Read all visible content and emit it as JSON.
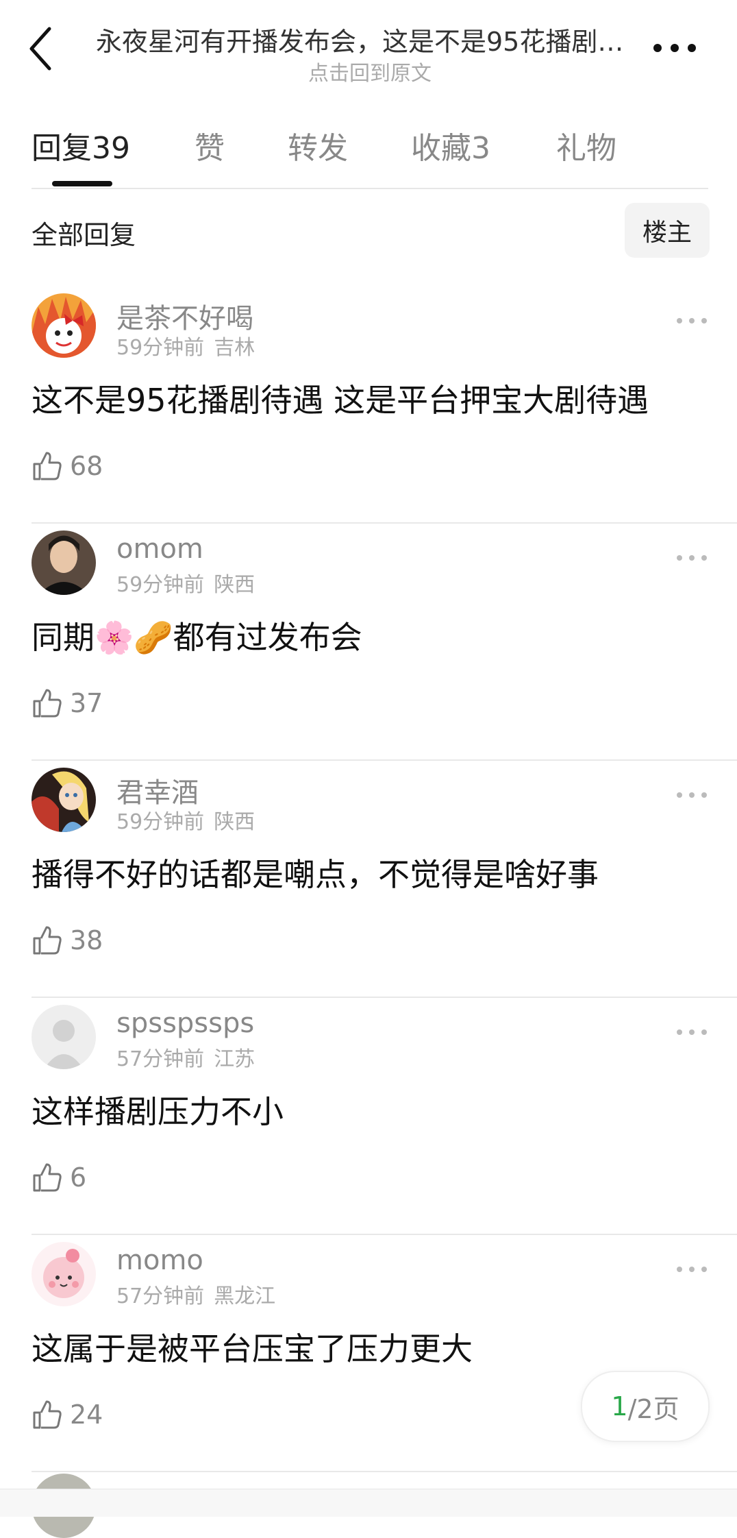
{
  "header": {
    "title": "永夜星河有开播发布会，这是不是95花播剧…",
    "subtitle": "点击回到原文"
  },
  "tabs": [
    {
      "label": "回复",
      "count": "39"
    },
    {
      "label": "赞",
      "count": ""
    },
    {
      "label": "转发",
      "count": ""
    },
    {
      "label": "收藏",
      "count": "3"
    },
    {
      "label": "礼物",
      "count": ""
    }
  ],
  "filter": {
    "label": "全部回复",
    "op_button": "楼主"
  },
  "comments": [
    {
      "user": "是茶不好喝",
      "time": "59分钟前",
      "location": "吉林",
      "text": "这不是95花播剧待遇 这是平台押宝大剧待遇",
      "likes": "68",
      "avatar": "cartoon-flame-avatar"
    },
    {
      "user": "omom",
      "time": "59分钟前",
      "location": "陕西",
      "text_before": "同期",
      "emoji": [
        "🌸",
        "🥜"
      ],
      "text_after": "都有过发布会",
      "likes": "37",
      "avatar": "photo-avatar"
    },
    {
      "user": "君幸酒",
      "time": "59分钟前",
      "location": "陕西",
      "text": "播得不好的话都是嘲点，不觉得是啥好事",
      "likes": "38",
      "avatar": "alice-avatar"
    },
    {
      "user": "spsspssps",
      "time": "57分钟前",
      "location": "江苏",
      "text": "这样播剧压力不小",
      "likes": "6",
      "avatar": "default-avatar"
    },
    {
      "user": "momo",
      "time": "57分钟前",
      "location": "黑龙江",
      "text": "这属于是被平台压宝了压力更大",
      "likes": "24",
      "avatar": "pink-cartoon-avatar"
    }
  ],
  "pager": {
    "current": "1",
    "rest": "/2页"
  },
  "colors": {
    "accent_green": "#2aa84a",
    "text_gray": "#888888"
  }
}
